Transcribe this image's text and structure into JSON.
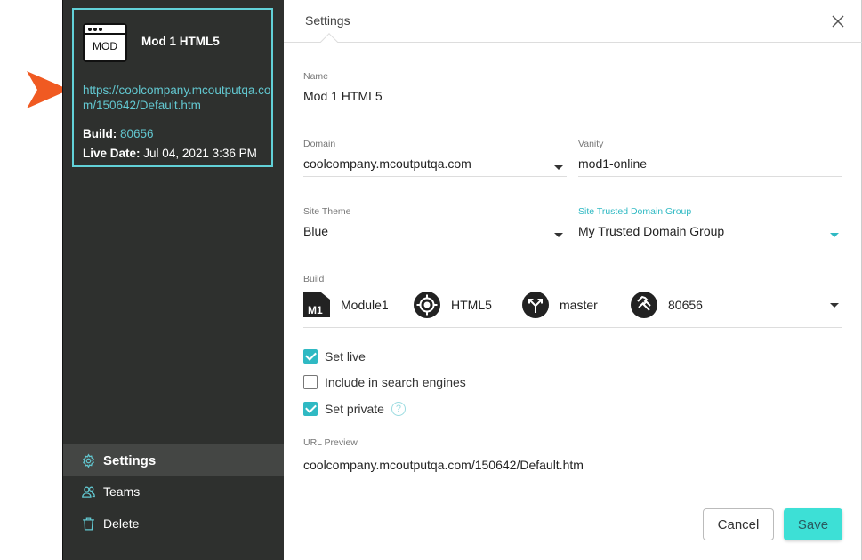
{
  "card": {
    "icon_text": "MOD",
    "title": "Mod 1 HTML5",
    "url": "https://coolcompany.mcoutputqa.com/150642/Default.htm",
    "build_label": "Build:",
    "build_value": "80656",
    "live_label": "Live Date:",
    "live_value": "Jul 04, 2021 3:36 PM"
  },
  "nav": {
    "settings": "Settings",
    "teams": "Teams",
    "delete": "Delete"
  },
  "tab": {
    "title": "Settings"
  },
  "form": {
    "name": {
      "label": "Name",
      "value": "Mod 1 HTML5"
    },
    "domain": {
      "label": "Domain",
      "value": "coolcompany.mcoutputqa.com"
    },
    "vanity": {
      "label": "Vanity",
      "value": "mod1-online"
    },
    "theme": {
      "label": "Site Theme",
      "value": "Blue"
    },
    "trusted": {
      "label": "Site Trusted Domain Group",
      "value": "My Trusted Domain Group"
    },
    "build": {
      "label": "Build",
      "m1_badge": "M1",
      "project": "Module1",
      "target": "HTML5",
      "branch": "master",
      "number": "80656"
    },
    "set_live": "Set live",
    "include_search": "Include in search engines",
    "set_private": "Set private",
    "help_glyph": "?",
    "url_preview": {
      "label": "URL Preview",
      "value": "coolcompany.mcoutputqa.com/150642/Default.htm"
    }
  },
  "buttons": {
    "cancel": "Cancel",
    "save": "Save"
  },
  "colors": {
    "accent": "#2fb9c3",
    "sidebar": "#2e302e",
    "save": "#3de0d6",
    "pointer": "#f05a22"
  }
}
